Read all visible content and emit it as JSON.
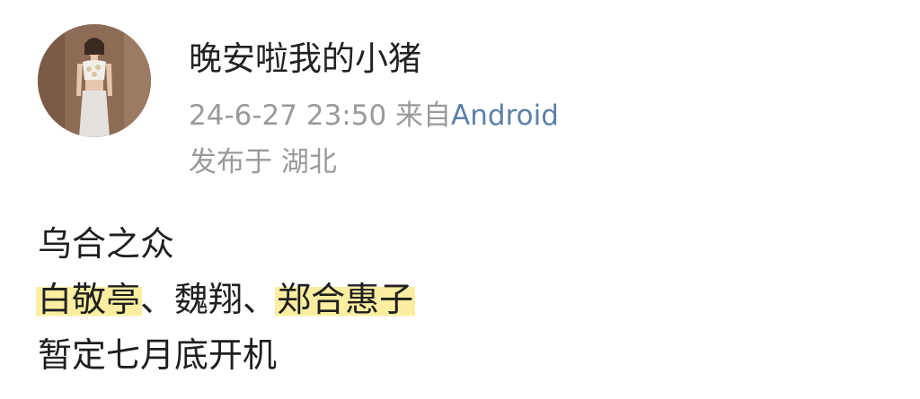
{
  "post": {
    "username": "晚安啦我的小猪",
    "timestamp": "24-6-27 23:50",
    "source_prefix": "来自",
    "source": "Android",
    "location": "发布于 湖北"
  },
  "content": {
    "line1": "乌合之众",
    "line2_part1": "白敬亭",
    "line2_sep1": "、",
    "line2_part2": "魏翔",
    "line2_sep2": "、",
    "line2_part3": "郑合惠子",
    "line3": "暂定七月底开机"
  },
  "colors": {
    "highlight": "#fbeea0",
    "source_link": "#5b7fa8",
    "meta_text": "#9a9a9a"
  },
  "avatar_icon": "user-avatar"
}
